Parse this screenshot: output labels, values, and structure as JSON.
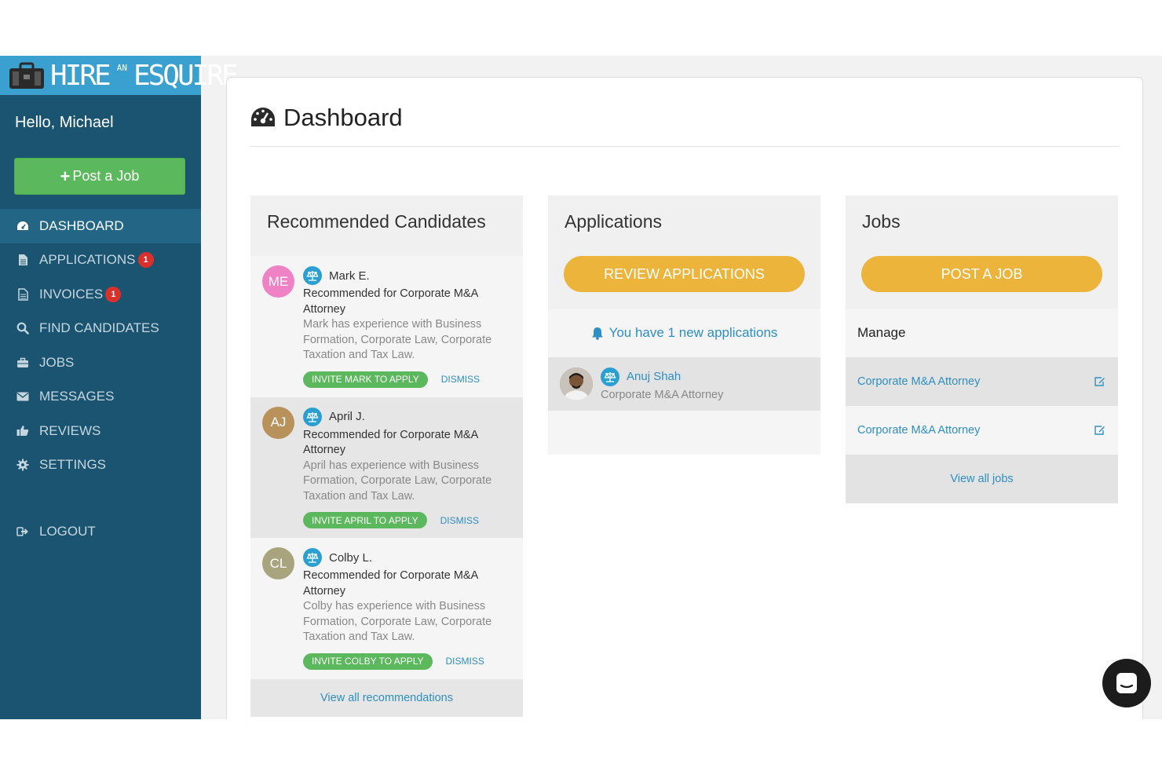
{
  "brand": {
    "logo_text_left": "HIRE",
    "logo_text_small": "AN",
    "logo_text_right": "ESQUIRE",
    "accent": "#3aa0cf",
    "sidebar_bg": "#1a5470"
  },
  "sidebar": {
    "greeting": "Hello, Michael",
    "post_job_label": "Post a Job",
    "items": [
      {
        "label": "DASHBOARD",
        "icon": "dashboard-icon",
        "active": true
      },
      {
        "label": "APPLICATIONS",
        "icon": "file-icon",
        "badge": "1"
      },
      {
        "label": "INVOICES",
        "icon": "invoice-icon",
        "badge": "1"
      },
      {
        "label": "FIND CANDIDATES",
        "icon": "search-icon"
      },
      {
        "label": "JOBS",
        "icon": "briefcase-icon"
      },
      {
        "label": "MESSAGES",
        "icon": "envelope-icon"
      },
      {
        "label": "REVIEWS",
        "icon": "thumbs-up-icon"
      },
      {
        "label": "SETTINGS",
        "icon": "gear-icon"
      }
    ],
    "logout_label": "LOGOUT"
  },
  "main": {
    "title": "Dashboard",
    "recommended": {
      "title": "Recommended Candidates",
      "candidates": [
        {
          "initials": "ME",
          "color": "#ee82c4",
          "name": "Mark E.",
          "rec": "Recommended for Corporate M&A Attorney",
          "desc": "Mark has experience with Business Formation, Corporate Law, Corporate Taxation and Tax Law.",
          "invite": "INVITE MARK TO APPLY",
          "dismiss": "DISMISS"
        },
        {
          "initials": "AJ",
          "color": "#b8925a",
          "name": "April J.",
          "rec": "Recommended for Corporate M&A Attorney",
          "desc": "April has experience with Business Formation, Corporate Law, Corporate Taxation and Tax Law.",
          "invite": "INVITE APRIL TO APPLY",
          "dismiss": "DISMISS"
        },
        {
          "initials": "CL",
          "color": "#a8a57e",
          "name": "Colby L.",
          "rec": "Recommended for Corporate M&A Attorney",
          "desc": "Colby has experience with Business Formation, Corporate Law, Corporate Taxation and Tax Law.",
          "invite": "INVITE COLBY TO APPLY",
          "dismiss": "DISMISS"
        }
      ],
      "view_all": "View all recommendations"
    },
    "applications": {
      "title": "Applications",
      "button": "REVIEW APPLICATIONS",
      "notice": "You have 1 new applications",
      "items": [
        {
          "name": "Anuj Shah",
          "role": "Corporate M&A Attorney"
        }
      ]
    },
    "jobs": {
      "title": "Jobs",
      "button": "POST A JOB",
      "manage_label": "Manage",
      "items": [
        {
          "title": "Corporate M&A Attorney"
        },
        {
          "title": "Corporate M&A Attorney"
        }
      ],
      "view_all": "View all jobs"
    }
  }
}
